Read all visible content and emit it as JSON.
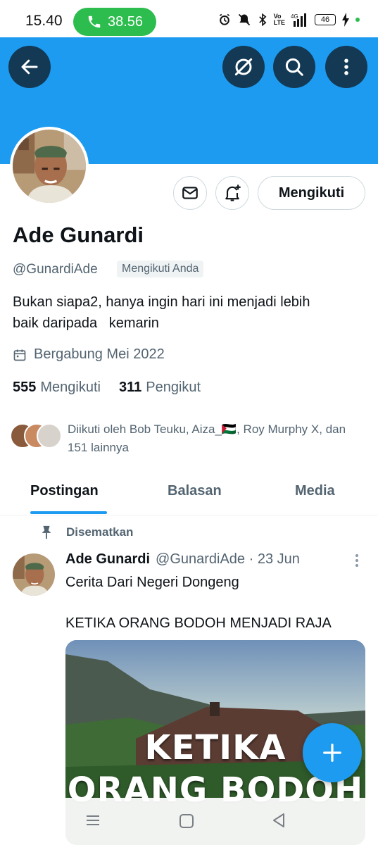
{
  "status_bar": {
    "time": "15.40",
    "call_duration": "38.56",
    "battery": "46",
    "icons": [
      "alarm-icon",
      "mute-icon",
      "bluetooth-icon",
      "volte-icon",
      "signal-4g-icon",
      "battery-icon",
      "charging-icon"
    ]
  },
  "header": {
    "back_icon": "arrow-left-icon",
    "grok_icon": "grok-icon",
    "search_icon": "search-icon",
    "more_icon": "more-vertical-icon",
    "banner_color": "#1d9bf0"
  },
  "profile": {
    "name": "Ade Gunardi",
    "handle": "@GunardiAde",
    "follows_you": "Mengikuti Anda",
    "bio": "Bukan siapa2, hanya ingin hari ini menjadi lebih\nbaik daripada   kemarin",
    "joined": "Bergabung Mei 2022",
    "following_count": "555",
    "following_label": "Mengikuti",
    "followers_count": "311",
    "followers_label": "Pengikut",
    "follow_button": "Mengikuti",
    "followed_by": "Diikuti oleh Bob Teuku, Aiza_🇵🇸, Roy Murphy X, dan 151 lainnya"
  },
  "tabs": [
    {
      "label": "Postingan",
      "active": true
    },
    {
      "label": "Balasan",
      "active": false
    },
    {
      "label": "Media",
      "active": false
    }
  ],
  "post": {
    "pinned_label": "Disematkan",
    "author_name": "Ade Gunardi",
    "author_meta": "@GunardiAde · 23 Jun",
    "text": "Cerita Dari Negeri Dongeng\n\nKETIKA ORANG BODOH MENJADI RAJA",
    "media_line1": "KETIKA",
    "media_line2": "ORANG BODOH"
  },
  "colors": {
    "accent": "#1d9bf0",
    "text_primary": "#0f1419",
    "text_secondary": "#536471"
  }
}
